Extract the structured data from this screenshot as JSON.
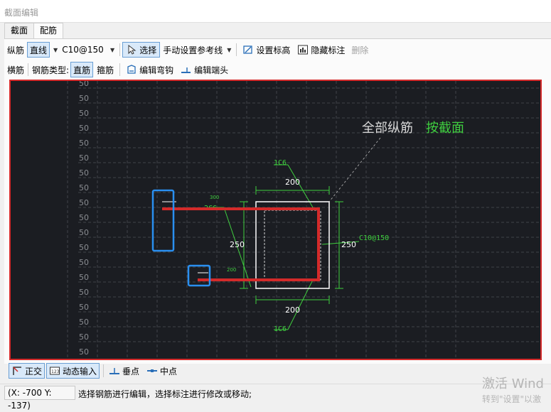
{
  "window": {
    "title": "截面编辑"
  },
  "tabs": [
    {
      "label": "截面"
    },
    {
      "label": "配筋"
    }
  ],
  "toolbar1": {
    "longitudinal_label": "纵筋",
    "shape_button": "直线",
    "spec_value": "C10@150",
    "select_button": "选择",
    "ref_line_button": "手动设置参考线",
    "elevation_button": "设置标高",
    "hide_dim_button": "隐藏标注",
    "delete_button": "删除"
  },
  "toolbar2": {
    "transverse_label": "横筋",
    "rebar_type_label": "钢筋类型:",
    "straight_button": "直筋",
    "stirrup_button": "箍筋",
    "edit_hook_button": "编辑弯钩",
    "edit_end_button": "编辑端头"
  },
  "canvas": {
    "row_label": "50",
    "annotation_prefix": "全部纵筋",
    "annotation_highlight": "按截面",
    "dim_top": "200",
    "dim_bottom": "200",
    "dim_left": "250",
    "dim_right": "250",
    "label_1c6_top": "1C6",
    "label_1c6_bottom": "1C6",
    "label_2c6": "2C6",
    "label_stirrup": "C10@150",
    "label_300": "300",
    "label_200": "200",
    "colors": {
      "background": "#1b1d22",
      "rebar": "#d42a2a",
      "dimension": "#3fcf3f",
      "section": "#ffffff",
      "highlight_box": "#2a8ff0"
    }
  },
  "bottom": {
    "ortho_button": "正交",
    "dynamic_input_button": "动态输入",
    "perpendicular_snap": "垂点",
    "midpoint_snap": "中点"
  },
  "status": {
    "coordinates": "(X: -700 Y: -137)",
    "message": "选择钢筋进行编辑，选择标注进行修改或移动;"
  },
  "watermark": {
    "line1": "激活 Wind",
    "line2": "转到\"设置\"以激"
  }
}
